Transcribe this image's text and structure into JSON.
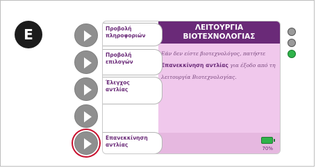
{
  "step": "E",
  "screen": {
    "title_line1": "ΛΕΙΤΟΥΡΓΙΑ",
    "title_line2": "ΒΙΟΤΕΧΝΟΛΟΓΙΑΣ",
    "message_part1": "Εάν δεν είστε βιοτεχνολόγος, πατήστε",
    "message_bold": "Επανεκκίνηση αντλίας",
    "message_part2": "για έξοδο από τη λειτουργία Βιοτεχνολογίας.",
    "battery_percent": "70%"
  },
  "tabs": [
    {
      "line1": "Προβολή",
      "line2": "πληροφοριών"
    },
    {
      "line1": "Προβολή",
      "line2": "επιλογών"
    },
    {
      "line1": "Έλεγχος",
      "line2": "αντλίας"
    },
    {
      "line1": "Επανεκκίνηση",
      "line2": "αντλίας"
    }
  ],
  "colors": {
    "title_bar": "#6a2a78",
    "content_bg": "#f0c8ec",
    "highlight_ring": "#c8102e",
    "indicator_green": "#2fb34a"
  }
}
